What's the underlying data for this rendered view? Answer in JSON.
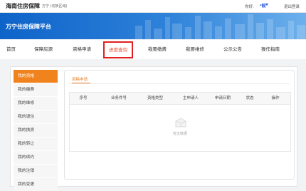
{
  "header": {
    "site_title": "海南住房保障",
    "region": "万宁 (切换区域)",
    "greeting": "你好:",
    "username": "*毅",
    "logout": "退出登录"
  },
  "banner": {
    "title": "万宁住房保障平台"
  },
  "nav": {
    "items": [
      {
        "label": "首页"
      },
      {
        "label": "保障房源"
      },
      {
        "label": "资格申请"
      },
      {
        "label": "进度查询"
      },
      {
        "label": "我要缴费"
      },
      {
        "label": "我要维修"
      },
      {
        "label": "公示公告"
      },
      {
        "label": "操作指南"
      }
    ],
    "active": "进度查询"
  },
  "sidebar": {
    "items": [
      {
        "label": "我的资格"
      },
      {
        "label": "我的缴费"
      },
      {
        "label": "我的维修"
      },
      {
        "label": "我的退住"
      },
      {
        "label": "我的换房"
      },
      {
        "label": "我的转让"
      },
      {
        "label": "我的续约"
      },
      {
        "label": "我的注销"
      },
      {
        "label": "我的变更"
      }
    ],
    "active": "我的资格"
  },
  "panel": {
    "tab": "资格申请",
    "columns": [
      "序号",
      "业务件号",
      "资格类型",
      "主申请人",
      "申请日期",
      "状态",
      "操作"
    ],
    "rows": [],
    "empty_text": "暂无数据"
  },
  "colors": {
    "accent": "#f0831e",
    "banner_blue": "#0e63c9",
    "highlight_red": "#e02020"
  }
}
